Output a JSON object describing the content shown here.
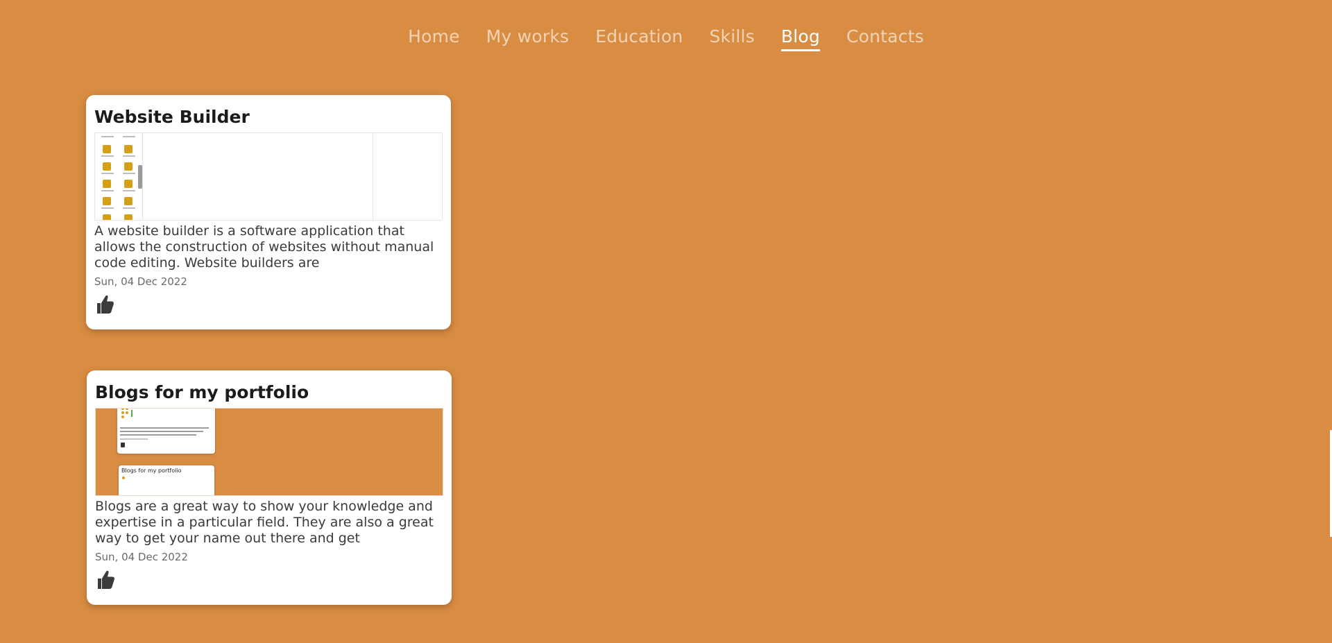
{
  "nav": {
    "items": [
      {
        "label": "Home"
      },
      {
        "label": "My works"
      },
      {
        "label": "Education"
      },
      {
        "label": "Skills"
      },
      {
        "label": "Blog"
      },
      {
        "label": "Contacts"
      }
    ],
    "active": "Blog"
  },
  "posts": [
    {
      "title": "Website Builder",
      "excerpt": "A website builder is a software application that allows the construction of websites without manual code editing. Website builders are",
      "date": "Sun, 04 Dec 2022",
      "like_icon": "thumbs-up-icon"
    },
    {
      "title": "Blogs for my portfolio",
      "excerpt": "Blogs are a great way to show your knowledge and expertise in a particular field. They are also a great way to get your name out there and get",
      "date": "Sun, 04 Dec 2022",
      "like_icon": "thumbs-up-icon",
      "thumb_mini_title": "Blogs for my portfolio"
    }
  ],
  "colors": {
    "background": "#D98D42",
    "nav_inactive": "#F3D3B4",
    "nav_active": "#FFFFFF",
    "card": "#FFFFFF",
    "tile": "#D4A017"
  }
}
